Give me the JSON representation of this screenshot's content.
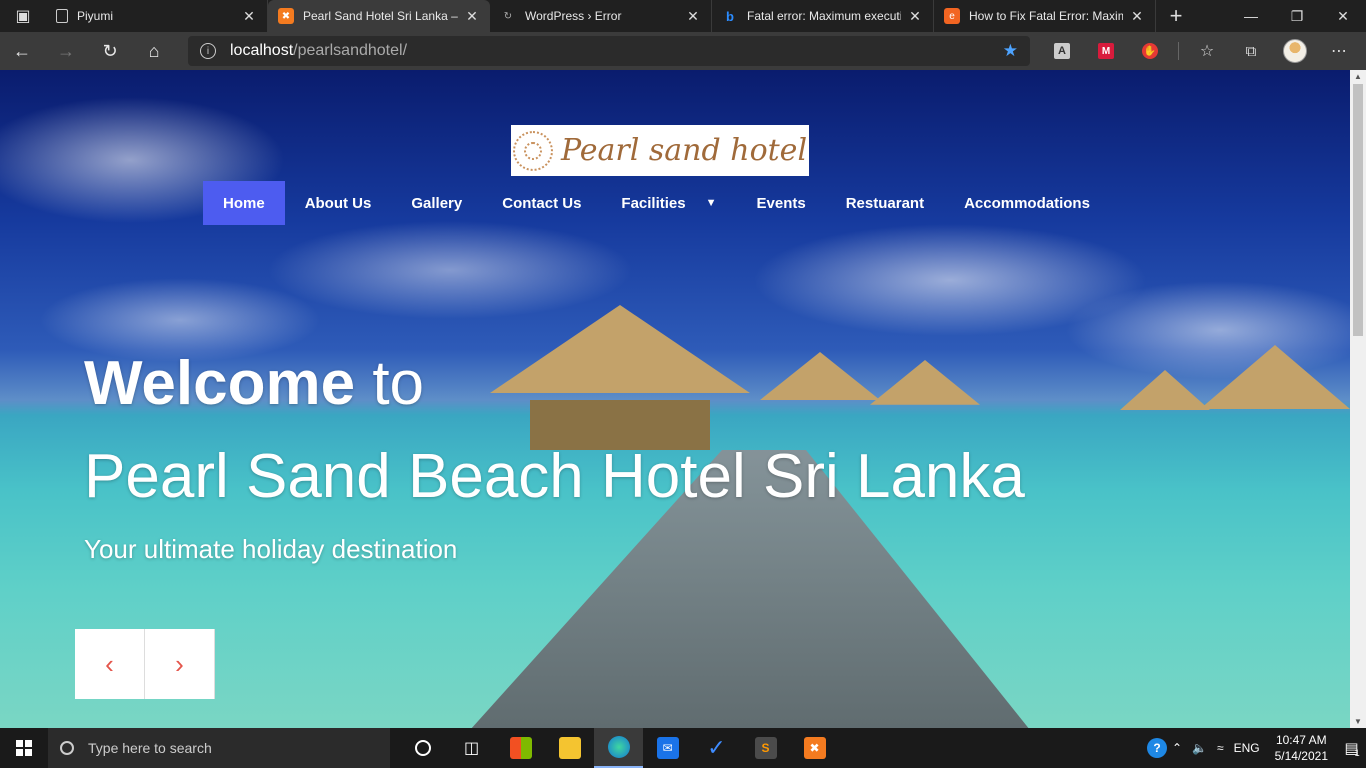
{
  "browser": {
    "tabs": [
      {
        "title": "Piyumi",
        "active": false
      },
      {
        "title": "Pearl Sand Hotel Sri Lanka – F",
        "active": true
      },
      {
        "title": "WordPress › Error",
        "active": false
      },
      {
        "title": "Fatal error: Maximum executi",
        "active": false
      },
      {
        "title": "How to Fix Fatal Error: Maxim",
        "active": false
      }
    ],
    "url_host": "localhost",
    "url_path": "/pearlsandhotel/"
  },
  "site": {
    "logo_text": "Pearl sand hotel",
    "nav": [
      {
        "label": "Home",
        "active": true
      },
      {
        "label": "About Us"
      },
      {
        "label": "Gallery"
      },
      {
        "label": "Contact Us"
      },
      {
        "label": "Facilities",
        "has_dropdown": true
      },
      {
        "label": "Events"
      },
      {
        "label": "Restuarant"
      },
      {
        "label": "Accommodations"
      }
    ],
    "hero": {
      "welcome_bold": "Welcome",
      "welcome_light": "to",
      "title": "Pearl Sand Beach Hotel Sri Lanka",
      "tagline": "Your ultimate holiday destination"
    },
    "slider": {
      "prev_icon": "‹",
      "next_icon": "›"
    },
    "accent_color": "#4d5cf0"
  },
  "taskbar": {
    "search_placeholder": "Type here to search",
    "language": "ENG",
    "time": "10:47 AM",
    "date": "5/14/2021",
    "notifications": "1"
  }
}
